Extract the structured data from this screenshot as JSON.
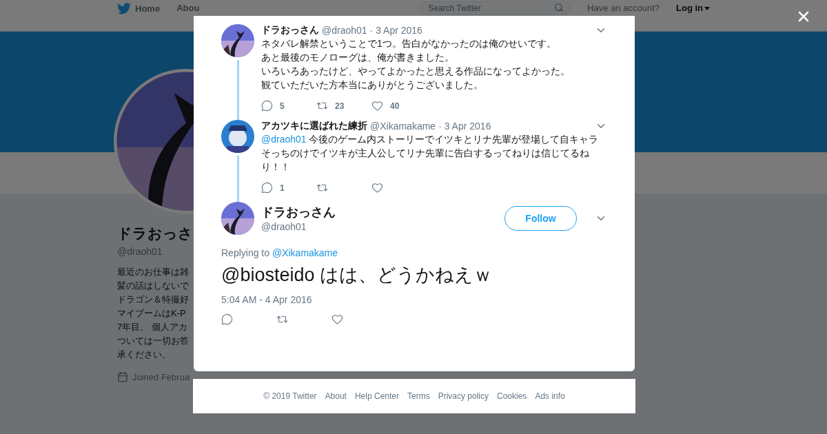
{
  "header": {
    "nav": [
      "Home",
      "Abou"
    ],
    "search": {
      "placeholder": "Search Twitter"
    },
    "account_prompt": "Have an account?",
    "login": "Log in"
  },
  "profile": {
    "name": "ドラおっさ",
    "handle": "@draoh01",
    "bio_lines": [
      "最近のお仕事は雑",
      "髪の話はしないで",
      "ドラゴン＆特撮好",
      "マイブームはK-P",
      "7年目。 個人アカ",
      "ついては一切お答",
      "承ください。"
    ],
    "joined": "Joined Februa"
  },
  "thread": [
    {
      "name": "ドラおっさん",
      "handle": "@draoh01",
      "date": "· 3 Apr 2016",
      "lines": [
        "ネタバレ解禁ということで1つ。告白がなかったのは俺のせいです。",
        "あと最後のモノローグは、俺が書きました。",
        "いろいろあったけど、やってよかったと思える作品になってよかった。",
        "観ていただいた方本当にありがとうございました。"
      ],
      "counts": {
        "replies": "5",
        "retweets": "23",
        "likes": "40"
      }
    },
    {
      "name": "アカツキに選ばれた練折",
      "handle": "@Xikamakame",
      "date": "· 3 Apr 2016",
      "mention": "@draoh01",
      "lines": [
        "今後のゲーム内ストーリーでイツキとリナ先輩が登場して自キャラ",
        "そっちのけでイツキが主人公してリナ先輩に告白するってねりは信じてるね",
        "り！！"
      ],
      "counts": {
        "replies": "1"
      }
    }
  ],
  "main_tweet": {
    "name": "ドラおっさん",
    "handle": "@draoh01",
    "follow": "Follow",
    "replying_prefix": "Replying to",
    "replying_to": "@Xikamakame",
    "text": "@biosteido はは、どうかねえｗ",
    "timestamp": "5:04 AM - 4 Apr 2016"
  },
  "footer": [
    "© 2019 Twitter",
    "About",
    "Help Center",
    "Terms",
    "Privacy policy",
    "Cookies",
    "Ads info"
  ]
}
